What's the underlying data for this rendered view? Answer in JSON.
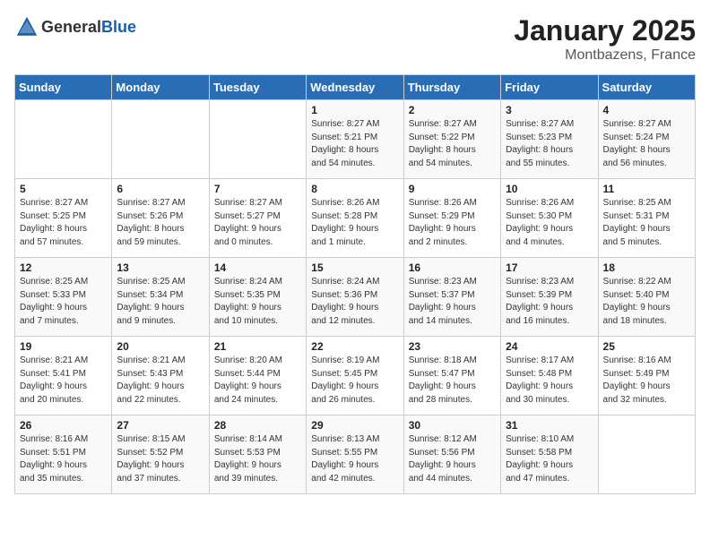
{
  "header": {
    "logo_general": "General",
    "logo_blue": "Blue",
    "month_year": "January 2025",
    "location": "Montbazens, France"
  },
  "days_of_week": [
    "Sunday",
    "Monday",
    "Tuesday",
    "Wednesday",
    "Thursday",
    "Friday",
    "Saturday"
  ],
  "weeks": [
    [
      {
        "day": "",
        "info": ""
      },
      {
        "day": "",
        "info": ""
      },
      {
        "day": "",
        "info": ""
      },
      {
        "day": "1",
        "info": "Sunrise: 8:27 AM\nSunset: 5:21 PM\nDaylight: 8 hours\nand 54 minutes."
      },
      {
        "day": "2",
        "info": "Sunrise: 8:27 AM\nSunset: 5:22 PM\nDaylight: 8 hours\nand 54 minutes."
      },
      {
        "day": "3",
        "info": "Sunrise: 8:27 AM\nSunset: 5:23 PM\nDaylight: 8 hours\nand 55 minutes."
      },
      {
        "day": "4",
        "info": "Sunrise: 8:27 AM\nSunset: 5:24 PM\nDaylight: 8 hours\nand 56 minutes."
      }
    ],
    [
      {
        "day": "5",
        "info": "Sunrise: 8:27 AM\nSunset: 5:25 PM\nDaylight: 8 hours\nand 57 minutes."
      },
      {
        "day": "6",
        "info": "Sunrise: 8:27 AM\nSunset: 5:26 PM\nDaylight: 8 hours\nand 59 minutes."
      },
      {
        "day": "7",
        "info": "Sunrise: 8:27 AM\nSunset: 5:27 PM\nDaylight: 9 hours\nand 0 minutes."
      },
      {
        "day": "8",
        "info": "Sunrise: 8:26 AM\nSunset: 5:28 PM\nDaylight: 9 hours\nand 1 minute."
      },
      {
        "day": "9",
        "info": "Sunrise: 8:26 AM\nSunset: 5:29 PM\nDaylight: 9 hours\nand 2 minutes."
      },
      {
        "day": "10",
        "info": "Sunrise: 8:26 AM\nSunset: 5:30 PM\nDaylight: 9 hours\nand 4 minutes."
      },
      {
        "day": "11",
        "info": "Sunrise: 8:25 AM\nSunset: 5:31 PM\nDaylight: 9 hours\nand 5 minutes."
      }
    ],
    [
      {
        "day": "12",
        "info": "Sunrise: 8:25 AM\nSunset: 5:33 PM\nDaylight: 9 hours\nand 7 minutes."
      },
      {
        "day": "13",
        "info": "Sunrise: 8:25 AM\nSunset: 5:34 PM\nDaylight: 9 hours\nand 9 minutes."
      },
      {
        "day": "14",
        "info": "Sunrise: 8:24 AM\nSunset: 5:35 PM\nDaylight: 9 hours\nand 10 minutes."
      },
      {
        "day": "15",
        "info": "Sunrise: 8:24 AM\nSunset: 5:36 PM\nDaylight: 9 hours\nand 12 minutes."
      },
      {
        "day": "16",
        "info": "Sunrise: 8:23 AM\nSunset: 5:37 PM\nDaylight: 9 hours\nand 14 minutes."
      },
      {
        "day": "17",
        "info": "Sunrise: 8:23 AM\nSunset: 5:39 PM\nDaylight: 9 hours\nand 16 minutes."
      },
      {
        "day": "18",
        "info": "Sunrise: 8:22 AM\nSunset: 5:40 PM\nDaylight: 9 hours\nand 18 minutes."
      }
    ],
    [
      {
        "day": "19",
        "info": "Sunrise: 8:21 AM\nSunset: 5:41 PM\nDaylight: 9 hours\nand 20 minutes."
      },
      {
        "day": "20",
        "info": "Sunrise: 8:21 AM\nSunset: 5:43 PM\nDaylight: 9 hours\nand 22 minutes."
      },
      {
        "day": "21",
        "info": "Sunrise: 8:20 AM\nSunset: 5:44 PM\nDaylight: 9 hours\nand 24 minutes."
      },
      {
        "day": "22",
        "info": "Sunrise: 8:19 AM\nSunset: 5:45 PM\nDaylight: 9 hours\nand 26 minutes."
      },
      {
        "day": "23",
        "info": "Sunrise: 8:18 AM\nSunset: 5:47 PM\nDaylight: 9 hours\nand 28 minutes."
      },
      {
        "day": "24",
        "info": "Sunrise: 8:17 AM\nSunset: 5:48 PM\nDaylight: 9 hours\nand 30 minutes."
      },
      {
        "day": "25",
        "info": "Sunrise: 8:16 AM\nSunset: 5:49 PM\nDaylight: 9 hours\nand 32 minutes."
      }
    ],
    [
      {
        "day": "26",
        "info": "Sunrise: 8:16 AM\nSunset: 5:51 PM\nDaylight: 9 hours\nand 35 minutes."
      },
      {
        "day": "27",
        "info": "Sunrise: 8:15 AM\nSunset: 5:52 PM\nDaylight: 9 hours\nand 37 minutes."
      },
      {
        "day": "28",
        "info": "Sunrise: 8:14 AM\nSunset: 5:53 PM\nDaylight: 9 hours\nand 39 minutes."
      },
      {
        "day": "29",
        "info": "Sunrise: 8:13 AM\nSunset: 5:55 PM\nDaylight: 9 hours\nand 42 minutes."
      },
      {
        "day": "30",
        "info": "Sunrise: 8:12 AM\nSunset: 5:56 PM\nDaylight: 9 hours\nand 44 minutes."
      },
      {
        "day": "31",
        "info": "Sunrise: 8:10 AM\nSunset: 5:58 PM\nDaylight: 9 hours\nand 47 minutes."
      },
      {
        "day": "",
        "info": ""
      }
    ]
  ]
}
